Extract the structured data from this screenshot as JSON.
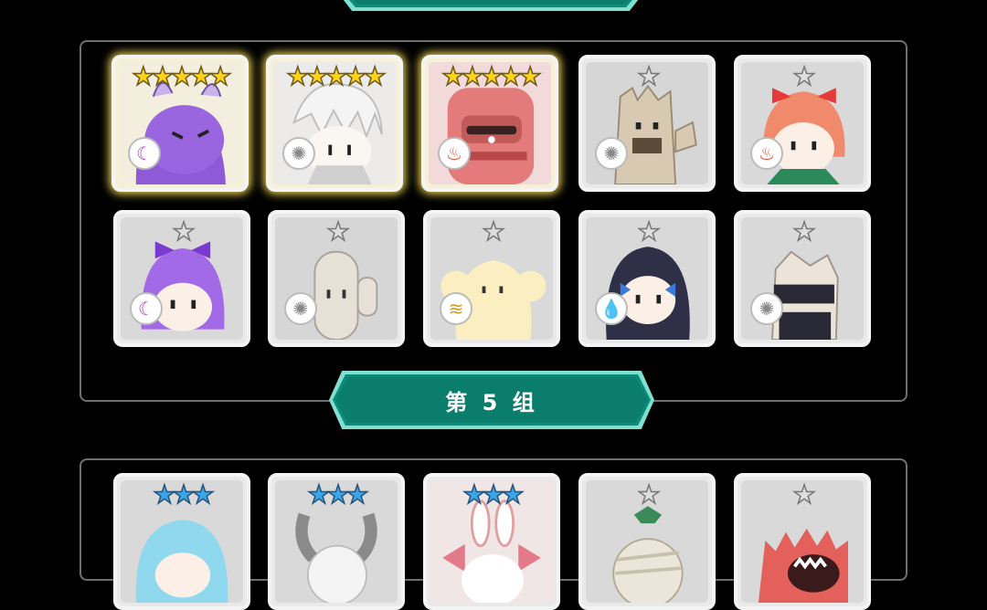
{
  "top_banner": {
    "label": ""
  },
  "group5_banner": {
    "label": "第 5 组"
  },
  "colors": {
    "accent": "#0e8a7a",
    "frame": "#6f6f6f",
    "gold_glow": "#ffe45a"
  },
  "group4": {
    "cards": [
      {
        "char": "purple dragon",
        "stars": "★★★★★",
        "star_type": "gold",
        "element": "moon-icon"
      },
      {
        "char": "white-haired knight",
        "stars": "★★★★★",
        "star_type": "gold",
        "element": "sun-icon"
      },
      {
        "char": "red golem",
        "stars": "★★★★★",
        "star_type": "gold",
        "element": "fire-icon"
      },
      {
        "char": "tree stump",
        "stars": "★",
        "star_type": "silver",
        "element": "sun-icon"
      },
      {
        "char": "orange-haired girl",
        "stars": "★",
        "star_type": "silver",
        "element": "fire-icon"
      },
      {
        "char": "purple-haired girl",
        "stars": "★",
        "star_type": "silver",
        "element": "moon-icon"
      },
      {
        "char": "cactus",
        "stars": "★",
        "star_type": "silver",
        "element": "sun-icon"
      },
      {
        "char": "yellow ghost",
        "stars": "★",
        "star_type": "silver",
        "element": "wind-icon"
      },
      {
        "char": "black-haired girl",
        "stars": "★",
        "star_type": "silver",
        "element": "water-icon"
      },
      {
        "char": "rock golem",
        "stars": "★",
        "star_type": "silver",
        "element": "sun-icon"
      }
    ]
  },
  "group5": {
    "cards": [
      {
        "char": "blue-haired girl",
        "stars": "★★★",
        "star_type": "blue"
      },
      {
        "char": "horned knight",
        "stars": "★★★",
        "star_type": "blue"
      },
      {
        "char": "rabbit",
        "stars": "★★★",
        "star_type": "blue"
      },
      {
        "char": "mummy",
        "stars": "★",
        "star_type": "silver"
      },
      {
        "char": "red monster",
        "stars": "★",
        "star_type": "silver"
      }
    ]
  }
}
